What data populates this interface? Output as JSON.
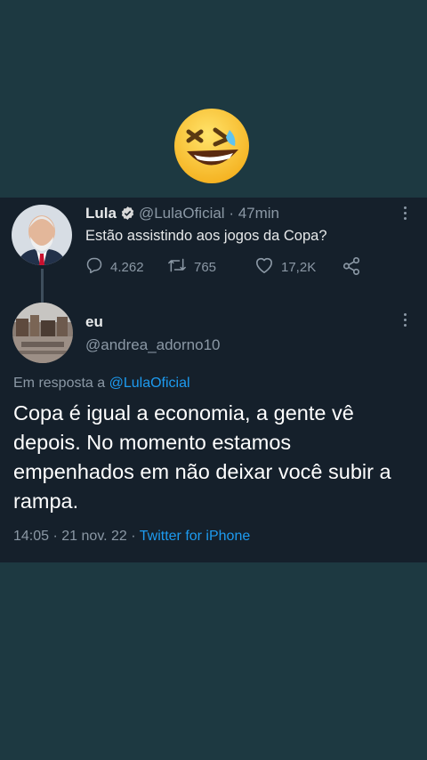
{
  "original_tweet": {
    "author_name": "Lula",
    "handle": "@LulaOficial",
    "time": "· 47min",
    "text": "Estão assistindo aos jogos da Copa?",
    "replies": "4.262",
    "retweets": "765",
    "likes": "17,2K"
  },
  "reply_tweet": {
    "author_name": "eu",
    "handle": "@andrea_adorno10",
    "reply_prefix": "Em resposta a",
    "reply_to": "@LulaOficial",
    "text": "Copa é igual a economia, a gente vê depois. No momento estamos empenhados em não deixar você subir a rampa.",
    "time": "14:05",
    "date": "· 21 nov. 22 ·",
    "source": "Twitter for iPhone"
  },
  "colors": {
    "background": "#1d3941",
    "card": "#15202b",
    "link": "#1d9bf0",
    "verified": "#d9d9d9",
    "muted": "#8b98a5"
  },
  "icons": [
    "laughing-emoji-icon",
    "verified-badge-icon",
    "reply-icon",
    "retweet-icon",
    "like-icon",
    "share-icon",
    "more-icon"
  ]
}
